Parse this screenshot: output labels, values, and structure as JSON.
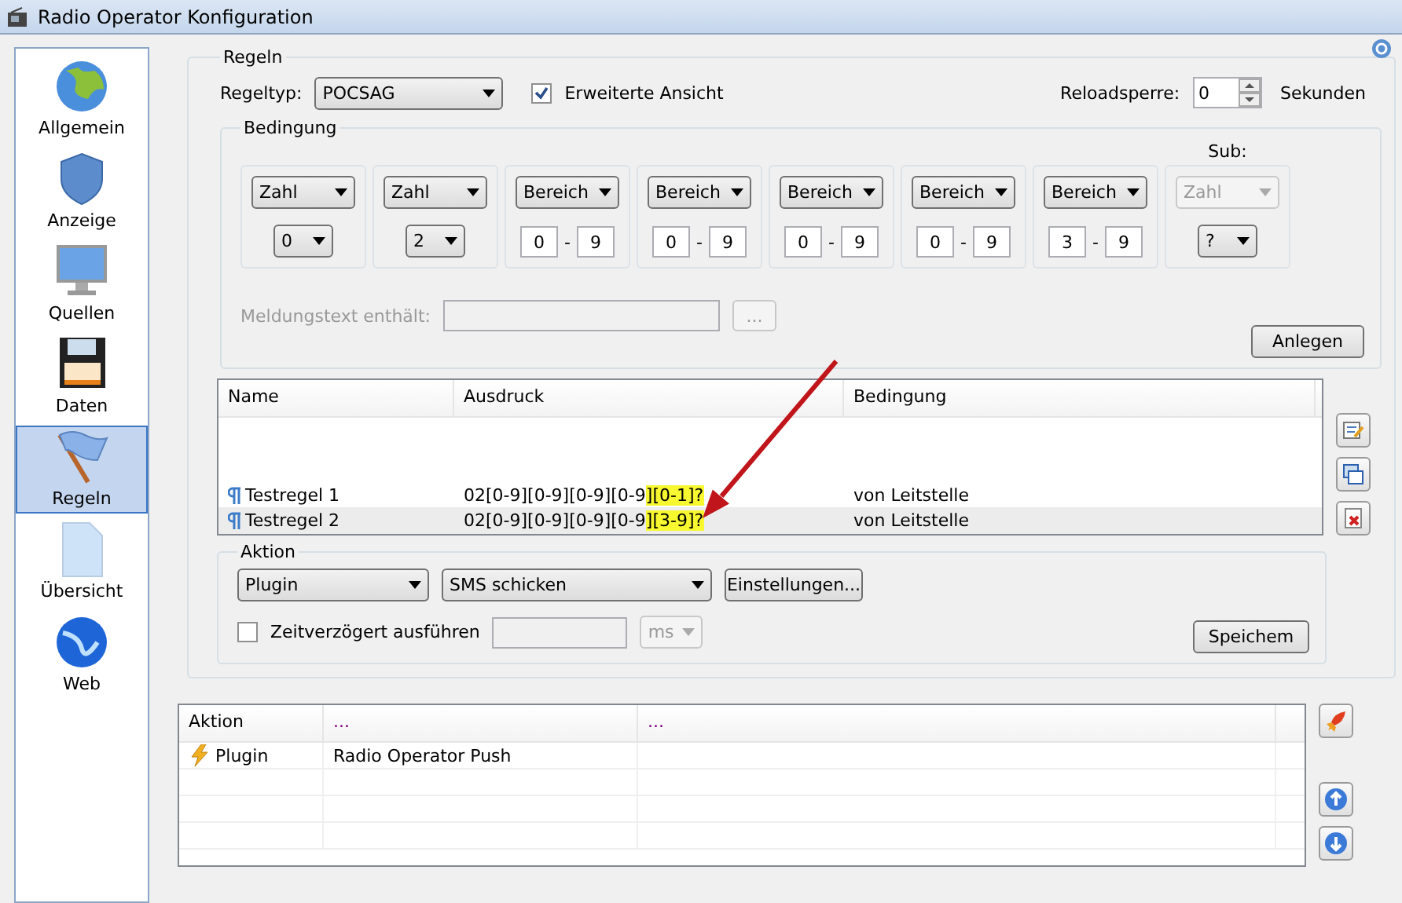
{
  "window": {
    "title": "Radio Operator Konfiguration"
  },
  "sidebar": {
    "items": [
      {
        "label": "Allgemein",
        "selected": false
      },
      {
        "label": "Anzeige",
        "selected": false
      },
      {
        "label": "Quellen",
        "selected": false
      },
      {
        "label": "Daten",
        "selected": false
      },
      {
        "label": "Regeln",
        "selected": true
      },
      {
        "label": "Übersicht",
        "selected": false
      },
      {
        "label": "Web",
        "selected": false
      }
    ]
  },
  "rules": {
    "title": "Regeln",
    "rule_type_label": "Regeltyp:",
    "rule_type": "POCSAG",
    "extended_view": {
      "label": "Erweiterte Ansicht",
      "checked": true
    },
    "reload_label": "Reloadsperre:",
    "reload_value": "0",
    "reload_unit": "Sekunden",
    "condition": {
      "title": "Bedingung",
      "sub_label": "Sub:",
      "cells": [
        {
          "kind": "number",
          "type": "Zahl",
          "value": "0",
          "disabled": false
        },
        {
          "kind": "number",
          "type": "Zahl",
          "value": "2",
          "disabled": false
        },
        {
          "kind": "range",
          "type": "Bereich",
          "from": "0",
          "separator": "-",
          "to": "9",
          "disabled": false
        },
        {
          "kind": "range",
          "type": "Bereich",
          "from": "0",
          "separator": "-",
          "to": "9",
          "disabled": false
        },
        {
          "kind": "range",
          "type": "Bereich",
          "from": "0",
          "separator": "-",
          "to": "9",
          "disabled": false
        },
        {
          "kind": "range",
          "type": "Bereich",
          "from": "0",
          "separator": "-",
          "to": "9",
          "disabled": false
        },
        {
          "kind": "range",
          "type": "Bereich",
          "from": "3",
          "separator": "-",
          "to": "9",
          "disabled": false
        },
        {
          "kind": "number",
          "type": "Zahl",
          "value": "?",
          "disabled": true
        }
      ],
      "message_label": "Meldungstext enthält:",
      "browse": "...",
      "add_button": "Anlegen"
    }
  },
  "rules_table": {
    "columns": [
      "Name",
      "Ausdruck",
      "Bedingung"
    ],
    "rows": [
      {
        "name": "Testregel 1",
        "expression": [
          {
            "text": "02[0-9][0-9][0-9][0-9",
            "highlight": false
          },
          {
            "text": "][0-1]?",
            "highlight": true
          }
        ],
        "condition": "von Leitstelle",
        "selected": false
      },
      {
        "name": "Testregel 2",
        "expression": [
          {
            "text": "02[0-9][0-9][0-9][0-9",
            "highlight": false
          },
          {
            "text": "][3-9]?",
            "highlight": true
          }
        ],
        "condition": "von Leitstelle",
        "selected": true
      }
    ]
  },
  "action": {
    "title": "Aktion",
    "type": "Plugin",
    "plugin": "SMS schicken",
    "settings_button": "Einstellungen...",
    "delay": {
      "label": "Zeitverzögert ausführen",
      "checked": false
    },
    "delay_unit": "ms",
    "save_button": "Speichem"
  },
  "action_table": {
    "columns": [
      "Aktion",
      "...",
      "..."
    ],
    "rows": [
      {
        "cells": [
          "Plugin",
          "Radio Operator Push",
          ""
        ]
      }
    ]
  }
}
